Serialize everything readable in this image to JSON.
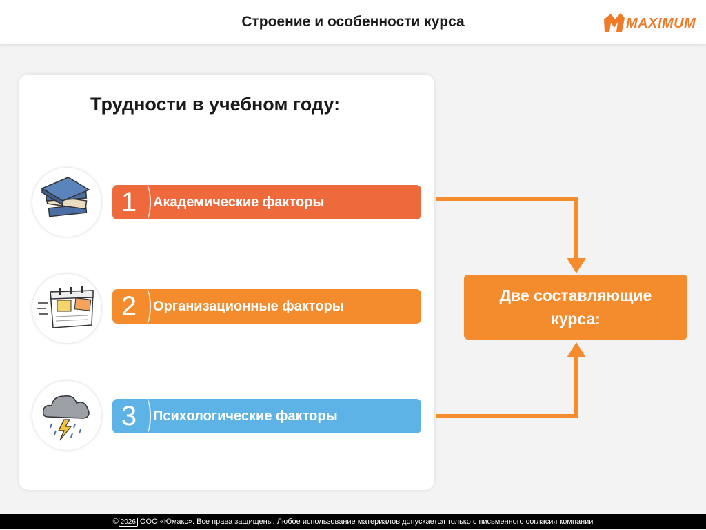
{
  "header": {
    "title": "Строение и особенности курса"
  },
  "logo": {
    "text": "MAXIMUM",
    "color": "#f07a28"
  },
  "card": {
    "title": "Трудности в учебном году:"
  },
  "factors": [
    {
      "number": "1",
      "label": "Академические факторы",
      "icon": "books-icon",
      "color": "#ee6a3c"
    },
    {
      "number": "2",
      "label": "Организационные факторы",
      "icon": "calendar-icon",
      "color": "#f48b2c"
    },
    {
      "number": "3",
      "label": "Психологические факторы",
      "icon": "storm-cloud-icon",
      "color": "#5db2e6"
    }
  ],
  "target": {
    "line1": "Две составляющие",
    "line2": "курса:",
    "color": "#f48b2c"
  },
  "footer": {
    "year": "2026",
    "text": "ООО «Юмакс». Все права защищены. Любое использование материалов допускается только с письменного согласия компании"
  }
}
